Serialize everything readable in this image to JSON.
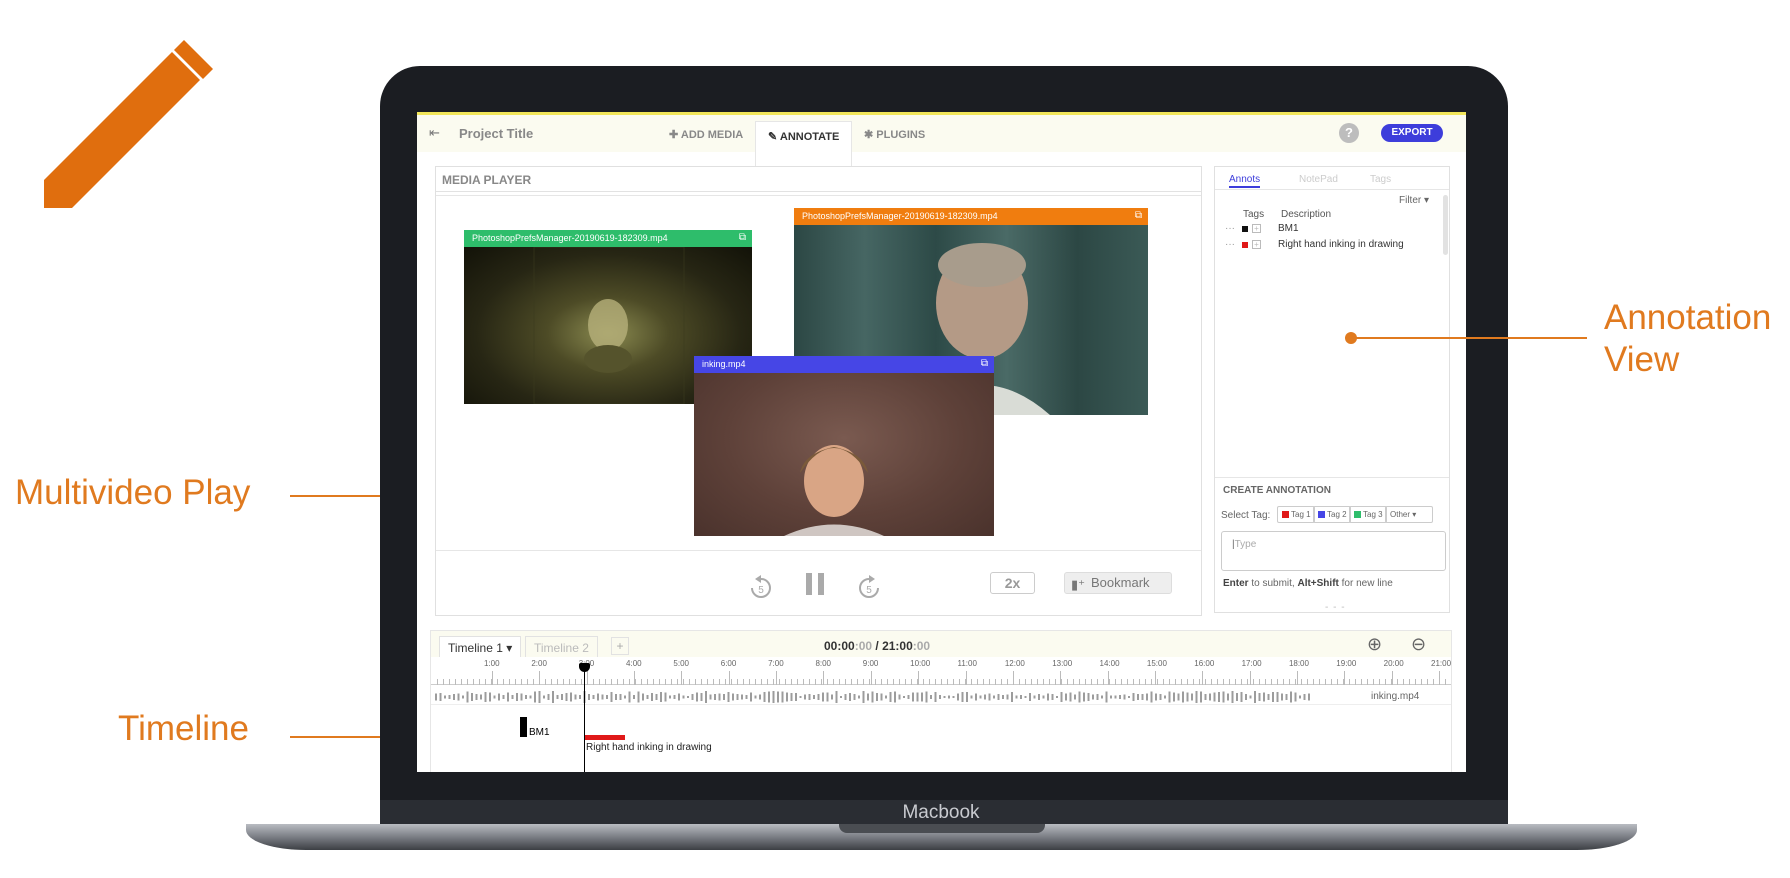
{
  "callouts": {
    "multivideo": "Multivideo Play",
    "timeline": "Timeline",
    "annotation_line1": "Annotation",
    "annotation_line2": "View"
  },
  "device": {
    "label": "Macbook"
  },
  "header": {
    "project_title": "Project Title",
    "tabs": [
      {
        "label": "ADD MEDIA",
        "icon": "plus-icon"
      },
      {
        "label": "ANNOTATE",
        "icon": "pencil-icon",
        "active": true
      },
      {
        "label": "PLUGINS",
        "icon": "puzzle-icon"
      }
    ],
    "help": "?",
    "export": "EXPORT"
  },
  "media_player": {
    "title": "MEDIA PLAYER",
    "videos": [
      {
        "name": "PhotoshopPrefsManager-20190619-182309.mp4",
        "color": "#2ebd6b"
      },
      {
        "name": "PhotoshopPrefsManager-20190619-182309.mp4",
        "color": "#f07d0f"
      },
      {
        "name": "inking.mp4",
        "color": "#4646e6"
      }
    ],
    "rewind": "5",
    "forward": "5",
    "speed": "2x",
    "bookmark": "Bookmark"
  },
  "annotations": {
    "tabs": [
      "Annots",
      "NotePad",
      "Tags"
    ],
    "filter": "Filter",
    "col_tags": "Tags",
    "col_desc": "Description",
    "rows": [
      {
        "dots": "···",
        "color": "#111111",
        "description": "BM1"
      },
      {
        "dots": "···",
        "color": "#e01919",
        "description": "Right hand inking in drawing"
      }
    ],
    "create": {
      "title": "CREATE ANNOTATION",
      "select_tag": "Select Tag:",
      "tags": [
        {
          "label": "Tag 1",
          "color": "#e01919"
        },
        {
          "label": "Tag 2",
          "color": "#4646e6"
        },
        {
          "label": "Tag 3",
          "color": "#2ebd6b"
        }
      ],
      "other": "Other",
      "placeholder": "Type",
      "hint_pre": "Enter",
      "hint_mid": " to submit, ",
      "hint_key": "Alt+Shift",
      "hint_post": " for new line",
      "handle": "- - -"
    }
  },
  "timeline": {
    "tabs": [
      "Timeline 1",
      "Timeline 2"
    ],
    "add": "+",
    "time_current_main": "00:00",
    "time_current_dim": ":00",
    "time_sep": " / ",
    "time_total_main": "21:00",
    "time_total_dim": ":00",
    "ticks": [
      "1:00",
      "2:00",
      "3:00",
      "4:00",
      "5:00",
      "6:00",
      "7:00",
      "8:00",
      "9:00",
      "10:00",
      "11:00",
      "12:00",
      "13:00",
      "14:00",
      "15:00",
      "16:00",
      "17:00",
      "18:00",
      "19:00",
      "20:00",
      "21:00"
    ],
    "track_label": "inking.mp4",
    "events": [
      {
        "label": "BM1"
      },
      {
        "label": "Right hand inking in drawing"
      }
    ]
  }
}
